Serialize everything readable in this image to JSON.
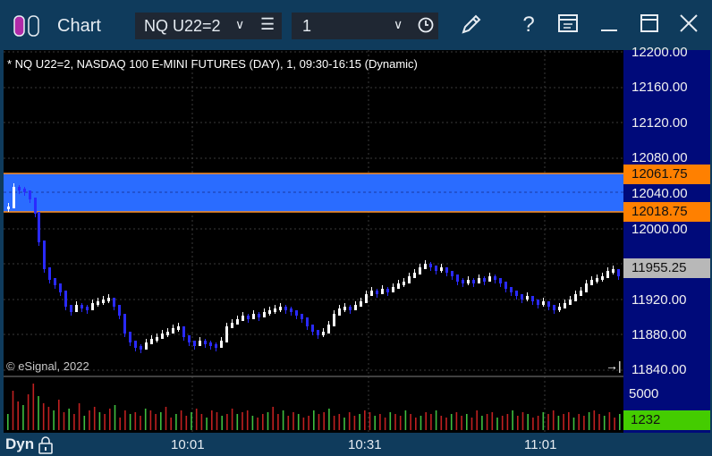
{
  "window": {
    "title": "Chart",
    "symbol": "NQ U22=2",
    "interval": "1",
    "buttons": [
      "edit-icon",
      "help-icon",
      "layout-icon",
      "minimize-icon",
      "maximize-icon",
      "close-icon"
    ],
    "help_glyph": "?"
  },
  "chart": {
    "legend": "* NQ U22=2, NASDAQ 100 E-MINI FUTURES (DAY), 1, 09:30-16:15 (Dynamic)",
    "copyright": "© eSignal, 2022",
    "price_labels": [
      "12200.00",
      "12160.00",
      "12120.00",
      "12080.00",
      "12040.00",
      "12000.00",
      "11920.00",
      "11880.00",
      "11840.00"
    ],
    "band_high": "12061.75",
    "band_low": "12018.75",
    "last_price": "11955.25",
    "volume_scale": "5000",
    "volume_last": "1232",
    "time_labels": [
      "10:01",
      "10:31",
      "11:01"
    ],
    "mode": "Dyn",
    "colors": {
      "up": "#ffffff",
      "down": "#2a2aff",
      "band": "#2a6cff",
      "band_edge": "#ff8c1a",
      "badge_orange": "#ff8000",
      "badge_gray": "#b8b8b8",
      "vol_up": "#3fbf3f",
      "vol_down": "#c02020",
      "vol_badge": "#44cc00"
    }
  }
}
